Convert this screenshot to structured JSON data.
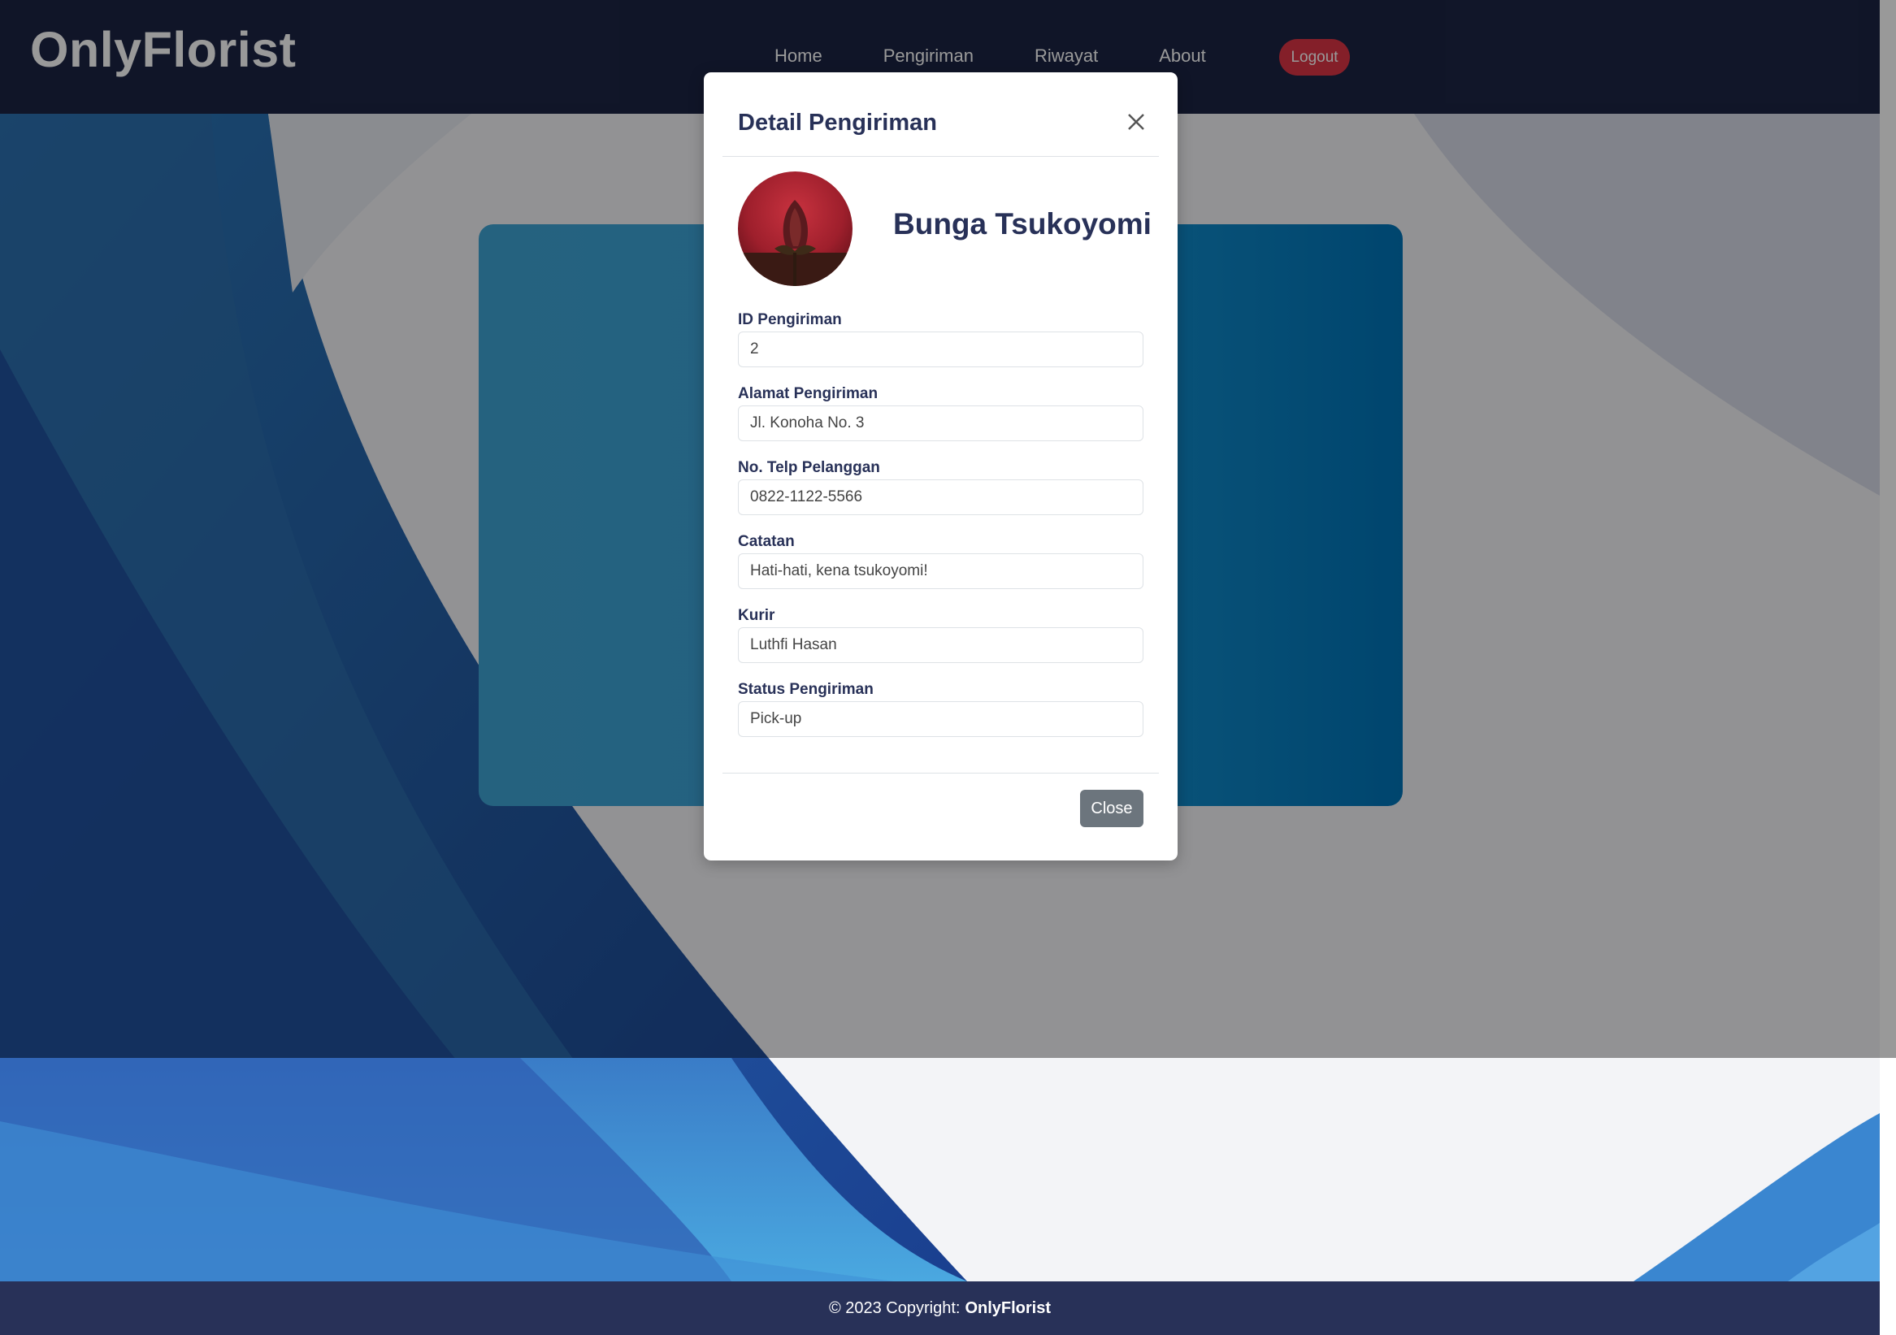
{
  "navbar": {
    "brand": "OnlyFlorist",
    "links": [
      "Home",
      "Pengiriman",
      "Riwayat",
      "About"
    ],
    "logout_label": "Logout"
  },
  "modal": {
    "title": "Detail Pengiriman",
    "flower_name": "Bunga Tsukoyomi",
    "fields": [
      {
        "label": "ID Pengiriman",
        "value": "2"
      },
      {
        "label": "Alamat Pengiriman",
        "value": "Jl. Konoha No. 3"
      },
      {
        "label": "No. Telp Pelanggan",
        "value": "0822-1122-5566"
      },
      {
        "label": "Catatan",
        "value": "Hati-hati, kena tsukoyomi!"
      },
      {
        "label": "Kurir",
        "value": "Luthfi Hasan"
      },
      {
        "label": "Status Pengiriman",
        "value": "Pick-up"
      }
    ],
    "close_label": "Close"
  },
  "footer": {
    "copyright": "© 2023 Copyright:",
    "brand": "OnlyFlorist"
  },
  "colors": {
    "navbar": "#1c2444",
    "footer": "#283158",
    "logout": "#dc3545",
    "close_button": "#6c757d"
  }
}
